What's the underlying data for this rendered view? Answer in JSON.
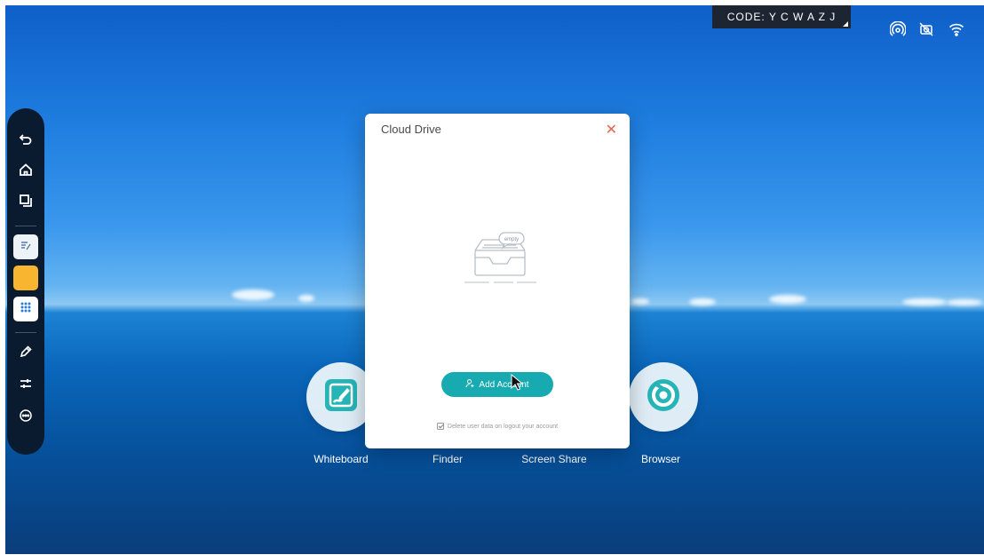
{
  "status_bar": {
    "code_text": "CODE: Y C W A Z J",
    "icons": [
      "hotspot-icon",
      "camera-off-icon",
      "wifi-icon"
    ]
  },
  "side_toolbar": {
    "buttons": [
      {
        "icon": "back-icon"
      },
      {
        "icon": "home-icon"
      },
      {
        "icon": "windows-icon"
      },
      {
        "icon": "note-app-icon"
      },
      {
        "icon": "yellow-app-icon"
      },
      {
        "icon": "apps-grid-icon"
      },
      {
        "icon": "pen-icon"
      },
      {
        "icon": "settings-sliders-icon"
      },
      {
        "icon": "more-icon"
      }
    ]
  },
  "dock": {
    "apps": [
      {
        "name": "whiteboard",
        "label": "Whiteboard"
      },
      {
        "name": "finder",
        "label": "Finder"
      },
      {
        "name": "screen-share",
        "label": "Screen Share"
      },
      {
        "name": "browser",
        "label": "Browser"
      }
    ]
  },
  "dialog": {
    "title": "Cloud Drive",
    "close_symbol": "✕",
    "empty_badge": "empty",
    "add_account_label": "Add Account",
    "delete_option_label": "Delete user data on logout your account",
    "colors": {
      "accent": "#17aab0",
      "close": "#e2664c"
    }
  }
}
